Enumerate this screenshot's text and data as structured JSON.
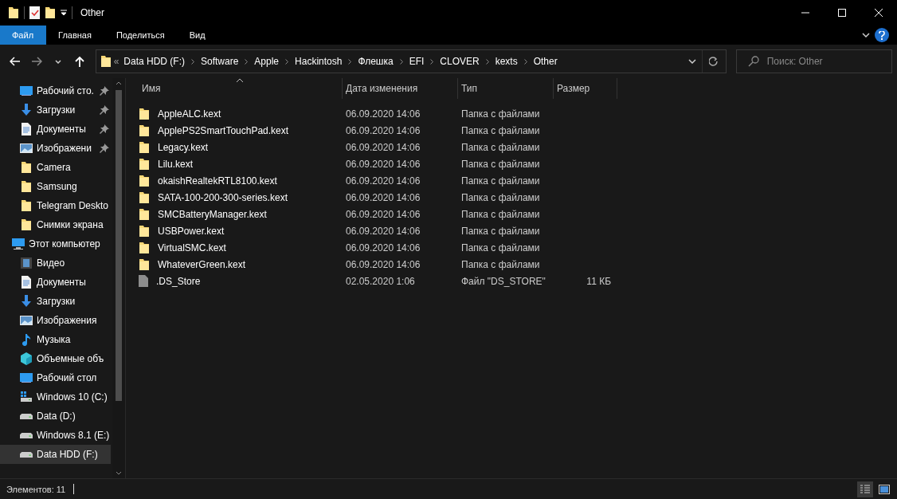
{
  "window": {
    "title": "Other"
  },
  "ribbon_tabs": [
    {
      "label": "Файл",
      "selected": true
    },
    {
      "label": "Главная",
      "selected": false
    },
    {
      "label": "Поделиться",
      "selected": false
    },
    {
      "label": "Вид",
      "selected": false
    }
  ],
  "address": {
    "overflow": "«",
    "segments": [
      "Data HDD (F:)",
      "Software",
      "Apple",
      "Hackintosh",
      "Флешка",
      "EFI",
      "CLOVER",
      "kexts",
      "Other"
    ]
  },
  "search": {
    "placeholder": "Поиск: Other"
  },
  "sidebar": {
    "items": [
      {
        "label": "Рабочий сто.",
        "kind": "desktop",
        "pinned": true,
        "selected": false
      },
      {
        "label": "Загрузки",
        "kind": "download",
        "pinned": true,
        "selected": false
      },
      {
        "label": "Документы",
        "kind": "document",
        "pinned": true,
        "selected": false
      },
      {
        "label": "Изображени",
        "kind": "image",
        "pinned": true,
        "selected": false
      },
      {
        "label": "Camera",
        "kind": "folder",
        "pinned": false,
        "selected": false
      },
      {
        "label": "Samsung",
        "kind": "folder",
        "pinned": false,
        "selected": false
      },
      {
        "label": "Telegram Deskto",
        "kind": "folder",
        "pinned": false,
        "selected": false
      },
      {
        "label": "Снимки экрана",
        "kind": "folder",
        "pinned": false,
        "selected": false
      },
      {
        "label": "Этот компьютер",
        "kind": "computer",
        "pinned": false,
        "selected": false,
        "children": [
          {
            "label": "Видео",
            "kind": "video",
            "pinned": false,
            "selected": false
          },
          {
            "label": "Документы",
            "kind": "document",
            "pinned": false,
            "selected": false
          },
          {
            "label": "Загрузки",
            "kind": "download",
            "pinned": false,
            "selected": false
          },
          {
            "label": "Изображения",
            "kind": "image",
            "pinned": false,
            "selected": false
          },
          {
            "label": "Музыка",
            "kind": "music",
            "pinned": false,
            "selected": false
          },
          {
            "label": "Объемные объ",
            "kind": "cube",
            "pinned": false,
            "selected": false
          },
          {
            "label": "Рабочий стол",
            "kind": "desktop",
            "pinned": false,
            "selected": false
          },
          {
            "label": "Windows 10 (C:)",
            "kind": "system-drive",
            "pinned": false,
            "selected": false
          },
          {
            "label": "Data (D:)",
            "kind": "drive",
            "pinned": false,
            "selected": false
          },
          {
            "label": "Windows 8.1 (E:)",
            "kind": "drive",
            "pinned": false,
            "selected": false
          },
          {
            "label": "Data HDD (F:)",
            "kind": "drive",
            "pinned": false,
            "selected": true
          }
        ]
      }
    ]
  },
  "table": {
    "columns": [
      "Имя",
      "Дата изменения",
      "Тип",
      "Размер"
    ],
    "rows": [
      {
        "kind": "folder",
        "name": "AppleALC.kext",
        "date": "06.09.2020 14:06",
        "type": "Папка с файлами"
      },
      {
        "kind": "folder",
        "name": "ApplePS2SmartTouchPad.kext",
        "date": "06.09.2020 14:06",
        "type": "Папка с файлами"
      },
      {
        "kind": "folder",
        "name": "Legacy.kext",
        "date": "06.09.2020 14:06",
        "type": "Папка с файлами"
      },
      {
        "kind": "folder",
        "name": "Lilu.kext",
        "date": "06.09.2020 14:06",
        "type": "Папка с файлами"
      },
      {
        "kind": "folder",
        "name": "okaishRealtekRTL8100.kext",
        "date": "06.09.2020 14:06",
        "type": "Папка с файлами"
      },
      {
        "kind": "folder",
        "name": "SATA-100-200-300-series.kext",
        "date": "06.09.2020 14:06",
        "type": "Папка с файлами"
      },
      {
        "kind": "folder",
        "name": "SMCBatteryManager.kext",
        "date": "06.09.2020 14:06",
        "type": "Папка с файлами"
      },
      {
        "kind": "folder",
        "name": "USBPower.kext",
        "date": "06.09.2020 14:06",
        "type": "Папка с файлами"
      },
      {
        "kind": "folder",
        "name": "VirtualSMC.kext",
        "date": "06.09.2020 14:06",
        "type": "Папка с файлами"
      },
      {
        "kind": "folder",
        "name": "WhateverGreen.kext",
        "date": "06.09.2020 14:06",
        "type": "Папка с файлами"
      },
      {
        "kind": "file",
        "name": ".DS_Store",
        "date": "02.05.2020 1:06",
        "type": "Файл \"DS_STORE\"",
        "size": "11 КБ"
      }
    ]
  },
  "status_bar": {
    "text": "Элементов: 11"
  }
}
